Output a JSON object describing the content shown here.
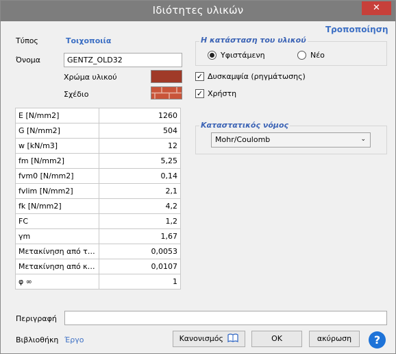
{
  "window": {
    "title": "Ιδιότητες υλικών",
    "close_glyph": "✕"
  },
  "type": {
    "label": "Τύπος",
    "value": "Τοιχοποιία",
    "modify_link": "Τροποποίηση"
  },
  "name": {
    "label": "Όνομα",
    "value": "GENTZ_OLD32"
  },
  "color": {
    "label": "Χρώμα υλικού",
    "swatch": "#a03a28"
  },
  "pattern": {
    "label": "Σχέδιο",
    "swatch_base": "#c9553a",
    "mortar": "#e8b3a3"
  },
  "properties": [
    {
      "name": "E [N/mm2]",
      "value": "1260"
    },
    {
      "name": "G [N/mm2]",
      "value": "504"
    },
    {
      "name": "w [kN/m3]",
      "value": "12"
    },
    {
      "name": "fm [N/mm2]",
      "value": "5,25"
    },
    {
      "name": "fvm0 [N/mm2]",
      "value": "0,14"
    },
    {
      "name": "fvlim [N/mm2]",
      "value": "2,1"
    },
    {
      "name": "fk [N/mm2]",
      "value": "4,2"
    },
    {
      "name": "FC",
      "value": "1,2"
    },
    {
      "name": "γm",
      "value": "1,67"
    },
    {
      "name": "Μετακίνηση από τέμ...",
      "value": "0,0053"
    },
    {
      "name": "Μετακίνηση από κάμψη",
      "value": "0,0107"
    },
    {
      "name": "φ ∞",
      "value": "1"
    }
  ],
  "state": {
    "title": "Η κατάσταση του υλικού",
    "existing": "Υφιστάμενη",
    "new": "Νέο",
    "selected": "existing"
  },
  "options": {
    "ductility_label": "Δυσκαμψία (ρηγμάτωσης)",
    "ductility_checked": true,
    "user_label": "Χρήστη",
    "user_checked": true,
    "check_glyph": "✓"
  },
  "constitutive": {
    "title": "Καταστατικός νόμος",
    "selected": "Mohr/Coulomb",
    "arrow": "⌄"
  },
  "description": {
    "label": "Περιγραφή",
    "value": ""
  },
  "library": {
    "label": "Βιβλιοθήκη",
    "value": "Έργο"
  },
  "buttons": {
    "regulation": "Κανονισμός",
    "ok": "OK",
    "cancel": "ακύρωση",
    "help": "?"
  }
}
